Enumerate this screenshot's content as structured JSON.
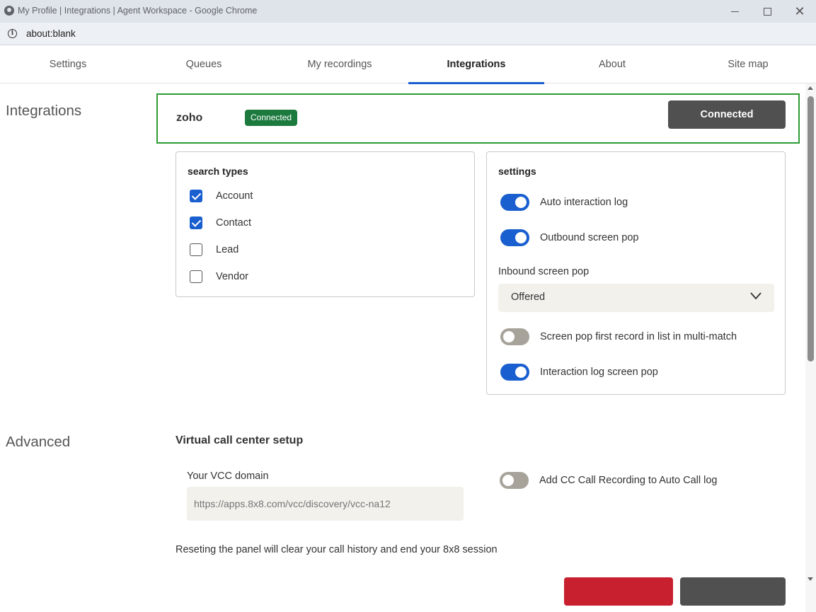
{
  "window": {
    "title": "My Profile | Integrations | Agent Workspace - Google Chrome",
    "url": "about:blank"
  },
  "tabs": [
    {
      "label": "Settings"
    },
    {
      "label": "Queues"
    },
    {
      "label": "My recordings"
    },
    {
      "label": "Integrations",
      "active": true
    },
    {
      "label": "About"
    },
    {
      "label": "Site map"
    }
  ],
  "integrations": {
    "heading": "Integrations",
    "name": "zoho",
    "status_badge": "Connected",
    "connect_button": "Connected",
    "search_types": {
      "title": "search types",
      "items": [
        {
          "label": "Account",
          "checked": true
        },
        {
          "label": "Contact",
          "checked": true
        },
        {
          "label": "Lead",
          "checked": false
        },
        {
          "label": "Vendor",
          "checked": false
        }
      ]
    },
    "settings": {
      "title": "settings",
      "toggles": [
        {
          "label": "Auto interaction log",
          "on": true
        },
        {
          "label": "Outbound screen pop",
          "on": true
        },
        {
          "label": "Screen pop first record in list in multi-match",
          "on": false
        },
        {
          "label": "Interaction log screen pop",
          "on": true
        }
      ],
      "inbound_label": "Inbound screen pop",
      "inbound_value": "Offered"
    }
  },
  "advanced": {
    "heading": "Advanced",
    "subtitle": "Virtual call center setup",
    "vcc_label": "Your VCC domain",
    "vcc_placeholder": "https://apps.8x8.com/vcc/discovery/vcc-na12",
    "recording_toggle": {
      "label": "Add CC Call Recording to Auto Call log",
      "on": false
    },
    "reset_note": "Reseting the panel will clear your call history and end your 8x8 session"
  },
  "colors": {
    "accent": "#1a5fcf",
    "connected_border": "#2c9a33",
    "badge": "#1c7a3f",
    "danger": "#c8202f"
  }
}
